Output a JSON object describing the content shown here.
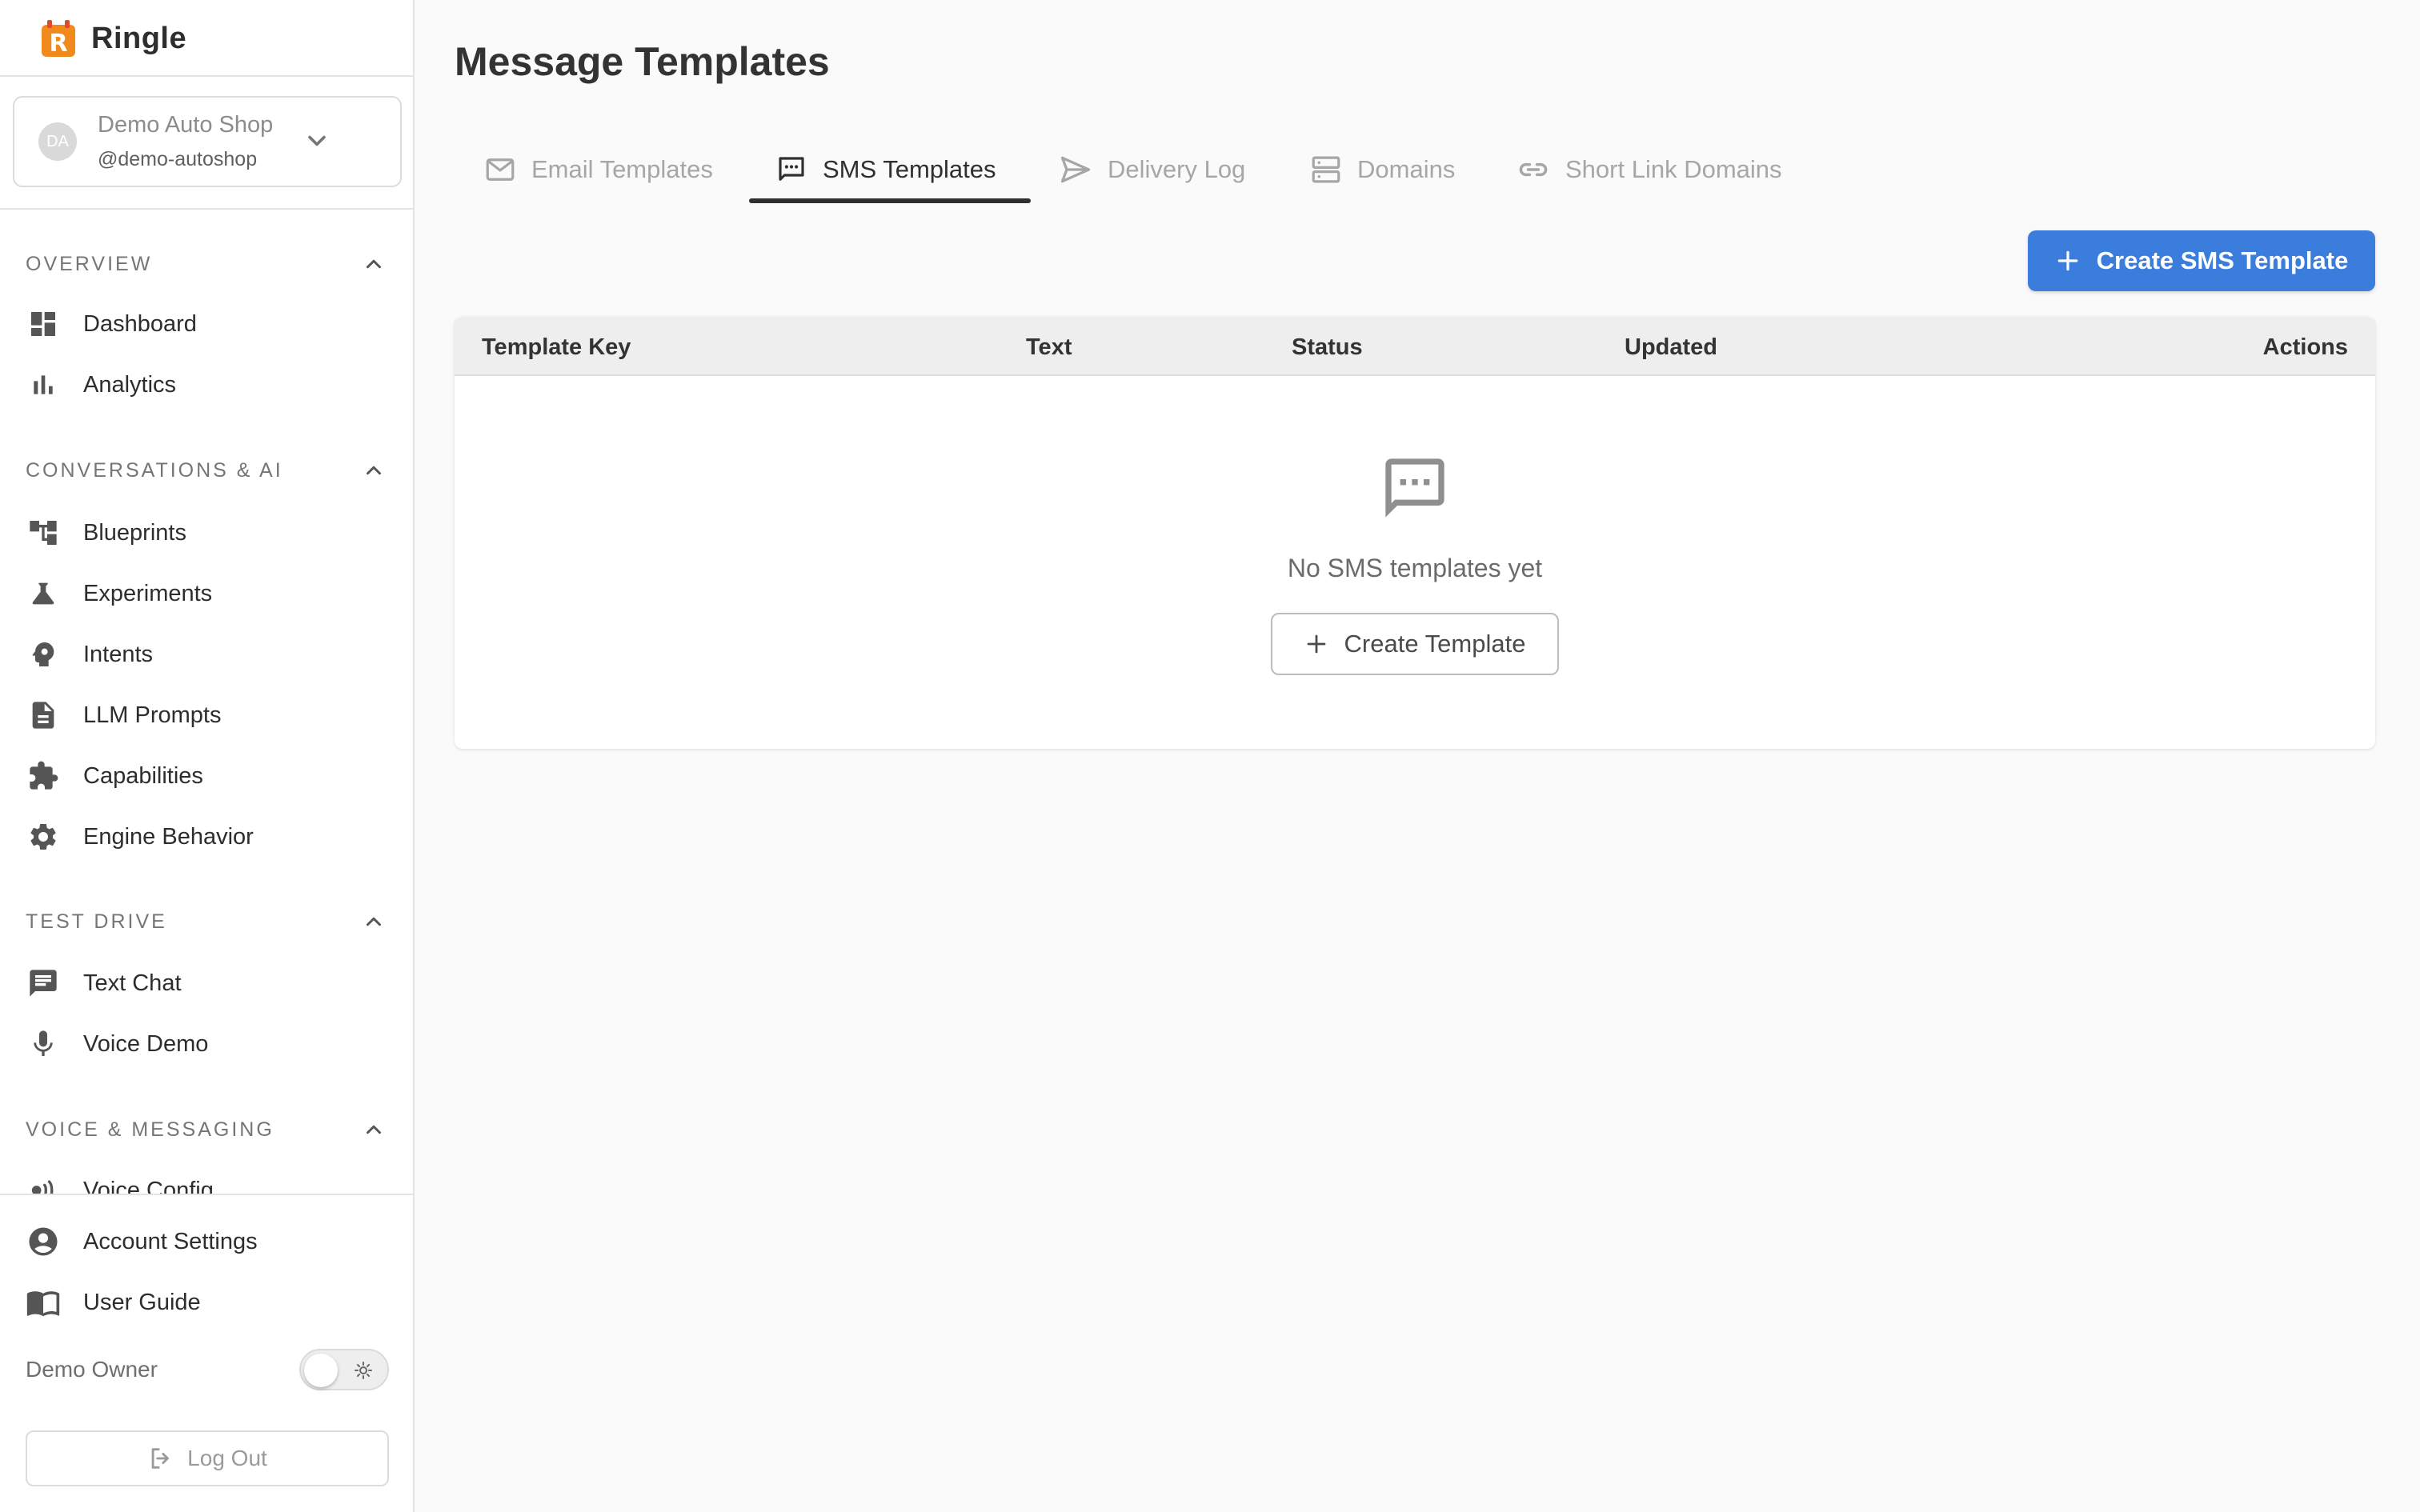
{
  "app": {
    "name": "Ringle"
  },
  "org": {
    "avatar_initials": "DA",
    "name": "Demo Auto Shop",
    "handle": "@demo-autoshop"
  },
  "sidebar": {
    "sections": [
      {
        "title": "OVERVIEW",
        "items": [
          {
            "label": "Dashboard",
            "icon": "dashboard-icon"
          },
          {
            "label": "Analytics",
            "icon": "bar-chart-icon"
          }
        ]
      },
      {
        "title": "CONVERSATIONS & AI",
        "items": [
          {
            "label": "Blueprints",
            "icon": "blueprint-tree-icon"
          },
          {
            "label": "Experiments",
            "icon": "flask-icon"
          },
          {
            "label": "Intents",
            "icon": "head-gear-icon"
          },
          {
            "label": "LLM Prompts",
            "icon": "document-icon"
          },
          {
            "label": "Capabilities",
            "icon": "puzzle-icon"
          },
          {
            "label": "Engine Behavior",
            "icon": "gear-icon"
          }
        ]
      },
      {
        "title": "TEST DRIVE",
        "items": [
          {
            "label": "Text Chat",
            "icon": "chat-bubble-icon"
          },
          {
            "label": "Voice Demo",
            "icon": "microphone-icon"
          }
        ]
      },
      {
        "title": "VOICE & MESSAGING",
        "items": [
          {
            "label": "Voice Config",
            "icon": "voice-wave-icon"
          }
        ]
      }
    ],
    "bottom": [
      {
        "label": "Account Settings",
        "icon": "account-circle-icon"
      },
      {
        "label": "User Guide",
        "icon": "book-icon"
      }
    ],
    "user": {
      "name": "Demo Owner",
      "theme_toggle": "light"
    },
    "logout_label": "Log Out"
  },
  "page": {
    "title": "Message Templates"
  },
  "tabs": [
    {
      "label": "Email Templates",
      "icon": "mail-icon",
      "active": false
    },
    {
      "label": "SMS Templates",
      "icon": "sms-icon",
      "active": true
    },
    {
      "label": "Delivery Log",
      "icon": "send-icon",
      "active": false
    },
    {
      "label": "Domains",
      "icon": "server-icon",
      "active": false
    },
    {
      "label": "Short Link Domains",
      "icon": "link-icon",
      "active": false
    }
  ],
  "actions": {
    "create_label": "Create SMS Template"
  },
  "table": {
    "columns": [
      "Template Key",
      "Text",
      "Status",
      "Updated",
      "Actions"
    ],
    "rows": [],
    "empty": {
      "message": "No SMS templates yet",
      "button_label": "Create Template"
    }
  },
  "colors": {
    "primary": "#3b7ddd",
    "brand": "#f08a1c",
    "text": "#2b2b2b",
    "muted": "#a6a6a6"
  }
}
